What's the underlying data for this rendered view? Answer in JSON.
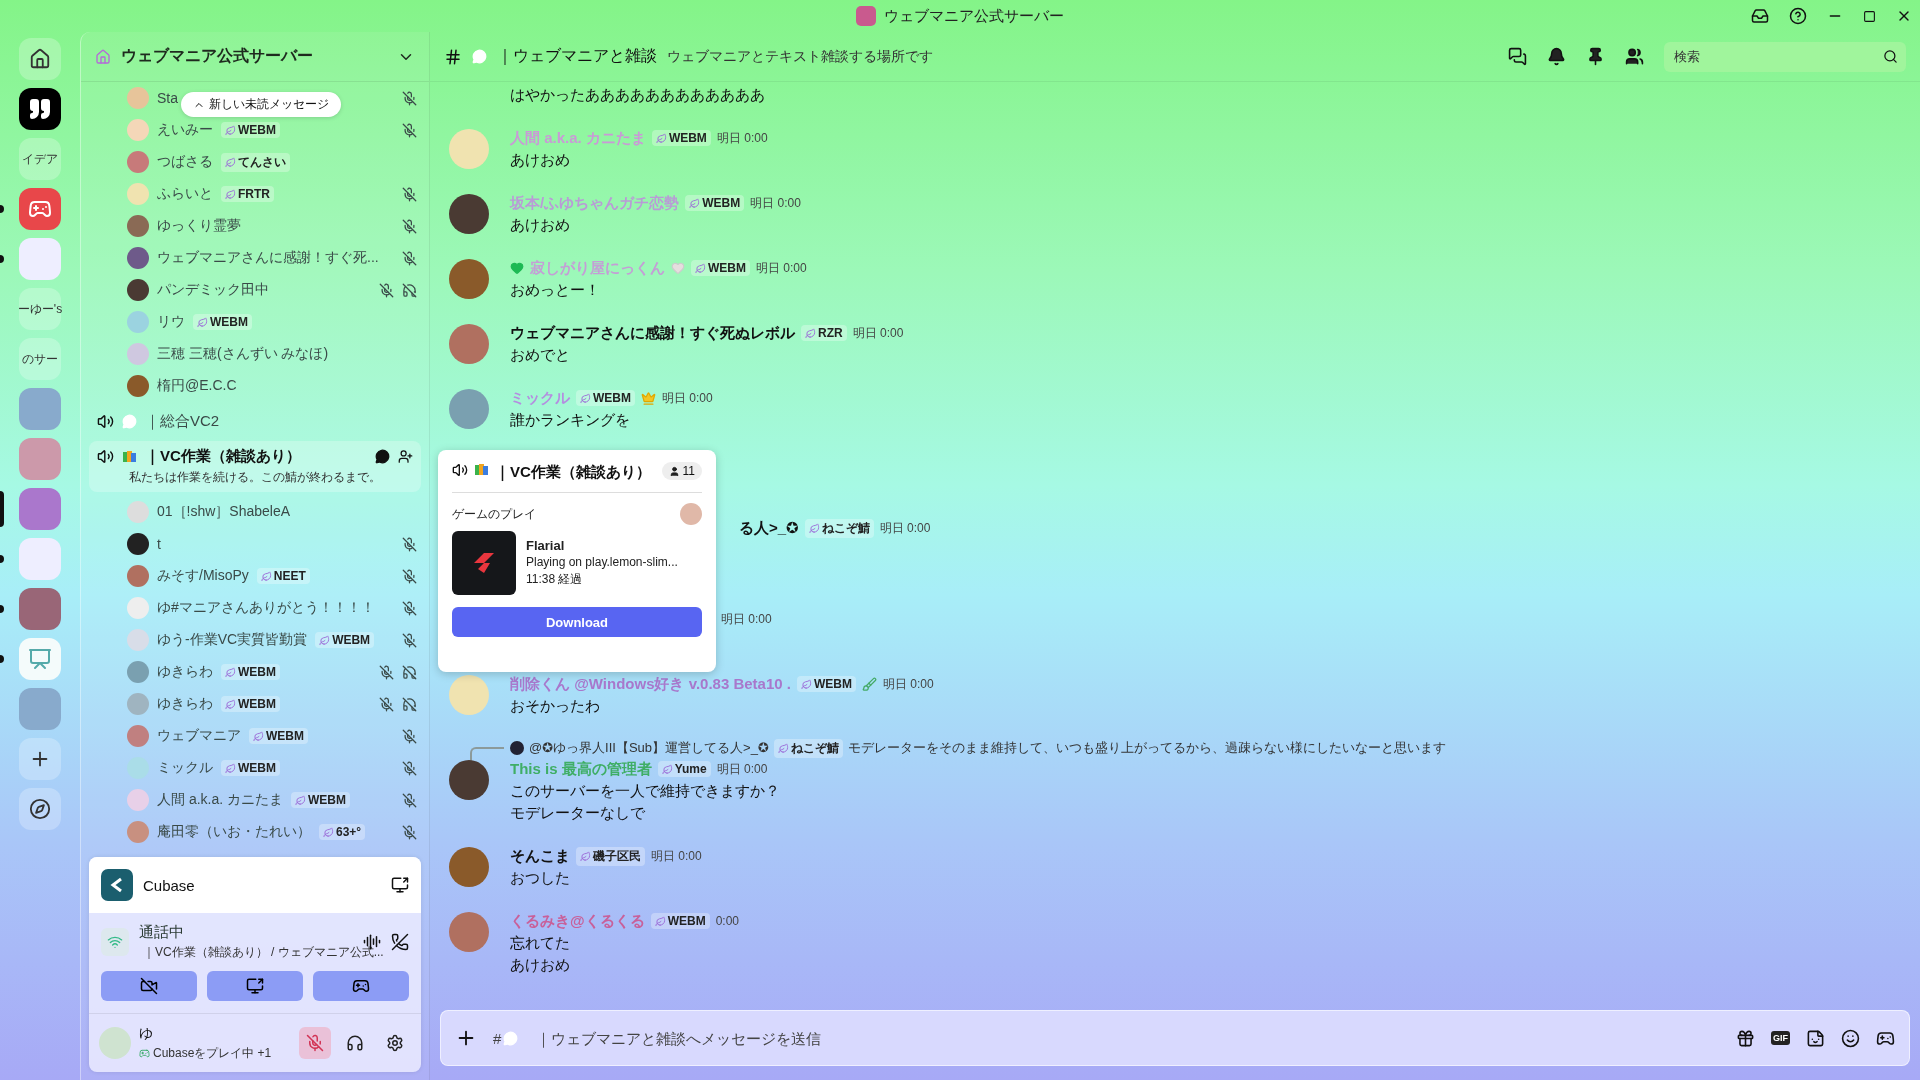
{
  "titlebar": {
    "title": "ウェブマニア公式サーバー"
  },
  "rail": [
    {
      "kind": "home",
      "selected": false,
      "unread": false
    },
    {
      "kind": "quote",
      "selected": false,
      "unread": false
    },
    {
      "kind": "text",
      "label": "イデア",
      "selected": false,
      "unread": false
    },
    {
      "kind": "logo",
      "selected": false,
      "unread": true
    },
    {
      "kind": "photo",
      "selected": false,
      "unread": true
    },
    {
      "kind": "text",
      "label": "ーゆー's",
      "selected": false,
      "unread": false
    },
    {
      "kind": "text",
      "label": "のサー",
      "selected": false,
      "unread": false
    },
    {
      "kind": "photo",
      "selected": false,
      "unread": false
    },
    {
      "kind": "photo",
      "selected": false,
      "unread": false
    },
    {
      "kind": "photo",
      "selected": true,
      "unread": false
    },
    {
      "kind": "photo",
      "selected": false,
      "unread": true
    },
    {
      "kind": "photo",
      "selected": false,
      "unread": true
    },
    {
      "kind": "easel",
      "selected": false,
      "unread": true
    },
    {
      "kind": "photo",
      "selected": false,
      "unread": false
    },
    {
      "kind": "add",
      "selected": false,
      "unread": false
    },
    {
      "kind": "explore",
      "selected": false,
      "unread": false
    }
  ],
  "server": {
    "name": "ウェブマニア公式サーバー",
    "unread_pill": "新しい未読メッセージ"
  },
  "sidebar": {
    "sections": [
      {
        "members": [
          {
            "name": "Sta",
            "muted": true,
            "deafened": false
          },
          {
            "name": "えいみー",
            "tag": "WEBM",
            "muted": true,
            "deafened": false
          },
          {
            "name": "つばさる",
            "tag": "てんさい",
            "muted": false,
            "deafened": false
          },
          {
            "name": "ふらいと",
            "tag": "FRTR",
            "muted": true,
            "deafened": false
          },
          {
            "name": "ゆっくり霊夢",
            "muted": true,
            "deafened": false
          },
          {
            "name": "ウェブマニアさんに感謝！すぐ死...",
            "muted": true,
            "deafened": false
          },
          {
            "name": "パンデミック田中",
            "muted": true,
            "deafened": true
          },
          {
            "name": "リウ",
            "tag": "WEBM",
            "muted": false,
            "deafened": false
          },
          {
            "name": "三穂 三穂(さんずい みなほ)",
            "muted": false,
            "deafened": false
          },
          {
            "name": "楕円@E.C.C",
            "muted": false,
            "deafened": false
          }
        ]
      },
      {
        "channel": {
          "name": "｜総合VC2",
          "selected": false
        }
      },
      {
        "channel": {
          "name": "｜VC作業（雑談あり）",
          "selected": true,
          "status": "私たちは作業を続ける。この鯖が終わるまで。"
        },
        "members": [
          {
            "name": "01［!shw］ShabeleA",
            "muted": false,
            "deafened": false
          },
          {
            "name": "t",
            "muted": true,
            "deafened": false
          },
          {
            "name": "みそす/MisoPy",
            "tag": "NEET",
            "muted": true,
            "deafened": false
          },
          {
            "name": "ゆ#マニアさんありがとう！！！！",
            "muted": true,
            "deafened": false
          },
          {
            "name": "ゆう-作業VC実質皆勤賞",
            "tag": "WEBM",
            "muted": true,
            "deafened": false
          },
          {
            "name": "ゆきらわ",
            "tag": "WEBM",
            "muted": true,
            "deafened": true
          },
          {
            "name": "ゆきらわ",
            "tag": "WEBM",
            "muted": true,
            "deafened": true
          },
          {
            "name": "ウェブマニア",
            "tag": "WEBM",
            "muted": true,
            "deafened": false
          },
          {
            "name": "ミックル",
            "tag": "WEBM",
            "muted": true,
            "deafened": false
          },
          {
            "name": "人間 a.k.a. カニたま",
            "tag": "WEBM",
            "muted": true,
            "deafened": false
          },
          {
            "name": "庵田零（いお・たれい）",
            "tag": "63+°",
            "muted": true,
            "deafened": false
          }
        ]
      }
    ]
  },
  "activity": {
    "app": "Cubase"
  },
  "call": {
    "status": "通話中",
    "channel": "｜VC作業（雑談あり） / ウェブマニア公式..."
  },
  "user": {
    "name": "ゆ",
    "activity": "Cubaseをプレイ中",
    "extra": "+1",
    "mic_muted": true
  },
  "header": {
    "channel": "｜ウェブマニアと雑談",
    "topic": "ウェブマニアとテキスト雑談する場所です",
    "search_placeholder": "検索"
  },
  "messages": [
    {
      "kind": "continuation",
      "lines": [
        "はやかったああああああああああああ"
      ]
    },
    {
      "kind": "message",
      "name": "人間 a.k.a. カニたま",
      "color": "#c99ad6",
      "tag": "WEBM",
      "time": "明日 0:00",
      "lines": [
        "あけおめ"
      ]
    },
    {
      "kind": "message",
      "name": "坂本/ふゆちゃんガチ恋勢",
      "color": "#b99bd6",
      "tag": "WEBM",
      "time": "明日 0:00",
      "lines": [
        "あけおめ"
      ]
    },
    {
      "kind": "message",
      "name": "寂しがり屋にっくん",
      "color": "#c49ed6",
      "hearts": true,
      "tag": "WEBM",
      "time": "明日 0:00",
      "lines": [
        "おめっとー！"
      ]
    },
    {
      "kind": "message",
      "name": "ウェブマニアさんに感謝！すぐ死ぬレボル",
      "color": "#111111",
      "tag": "RZR",
      "time": "明日 0:00",
      "lines": [
        "おめでと"
      ]
    },
    {
      "kind": "message",
      "name": "ミックル",
      "color": "#b48ee0",
      "tag": "WEBM",
      "crowned": true,
      "time": "明日 0:00",
      "lines": [
        "誰かランキングを"
      ]
    },
    {
      "kind": "covered",
      "name": "る人>_✪",
      "color": "#111111",
      "tag": "ねこぞ鯖",
      "time": "明日 0:00"
    },
    {
      "kind": "covered",
      "time": "明日 0:00"
    },
    {
      "kind": "message",
      "name": "削除くん @Windows好き v.0.83 Beta10 .",
      "color": "#a878cc",
      "tag": "WEBM",
      "brushed": true,
      "time": "明日 0:00",
      "lines": [
        "おそかったわ"
      ]
    },
    {
      "kind": "message",
      "reply": {
        "name": "@✪ゆっ界人III【Sub】運営してる人>_✪",
        "tag": "ねこぞ鯖",
        "text": "モデレーターをそのまま維持して、いつも盛り上がってるから、過疎らない様にしたいなーと思います"
      },
      "name": "This is 最高の管理者",
      "color": "#3fae66",
      "tag": "Yume",
      "time": "明日 0:00",
      "lines": [
        "このサーバーを一人で維持できますか？",
        "モデレーターなしで"
      ]
    },
    {
      "kind": "message",
      "name": "そんこま",
      "color": "#111111",
      "tag": "磯子区民",
      "time": "明日 0:00",
      "lines": [
        "おつした"
      ]
    },
    {
      "kind": "message",
      "name": "くるみき@くるくる",
      "color": "#c8609a",
      "tag": "WEBM",
      "time": "0:00",
      "lines": [
        "忘れてた",
        "あけおめ"
      ]
    }
  ],
  "popup": {
    "channel": "｜VC作業（雑談あり）",
    "count": "11",
    "section": "ゲームのプレイ",
    "game": {
      "title": "Flarial",
      "detail": "Playing on play.lemon-slim...",
      "elapsed": "11:38 経過"
    },
    "button": "Download"
  },
  "composer": {
    "prefix": "#",
    "placeholder": "｜ウェブマニアと雑談へメッセージを送信",
    "gif": "GIF"
  }
}
